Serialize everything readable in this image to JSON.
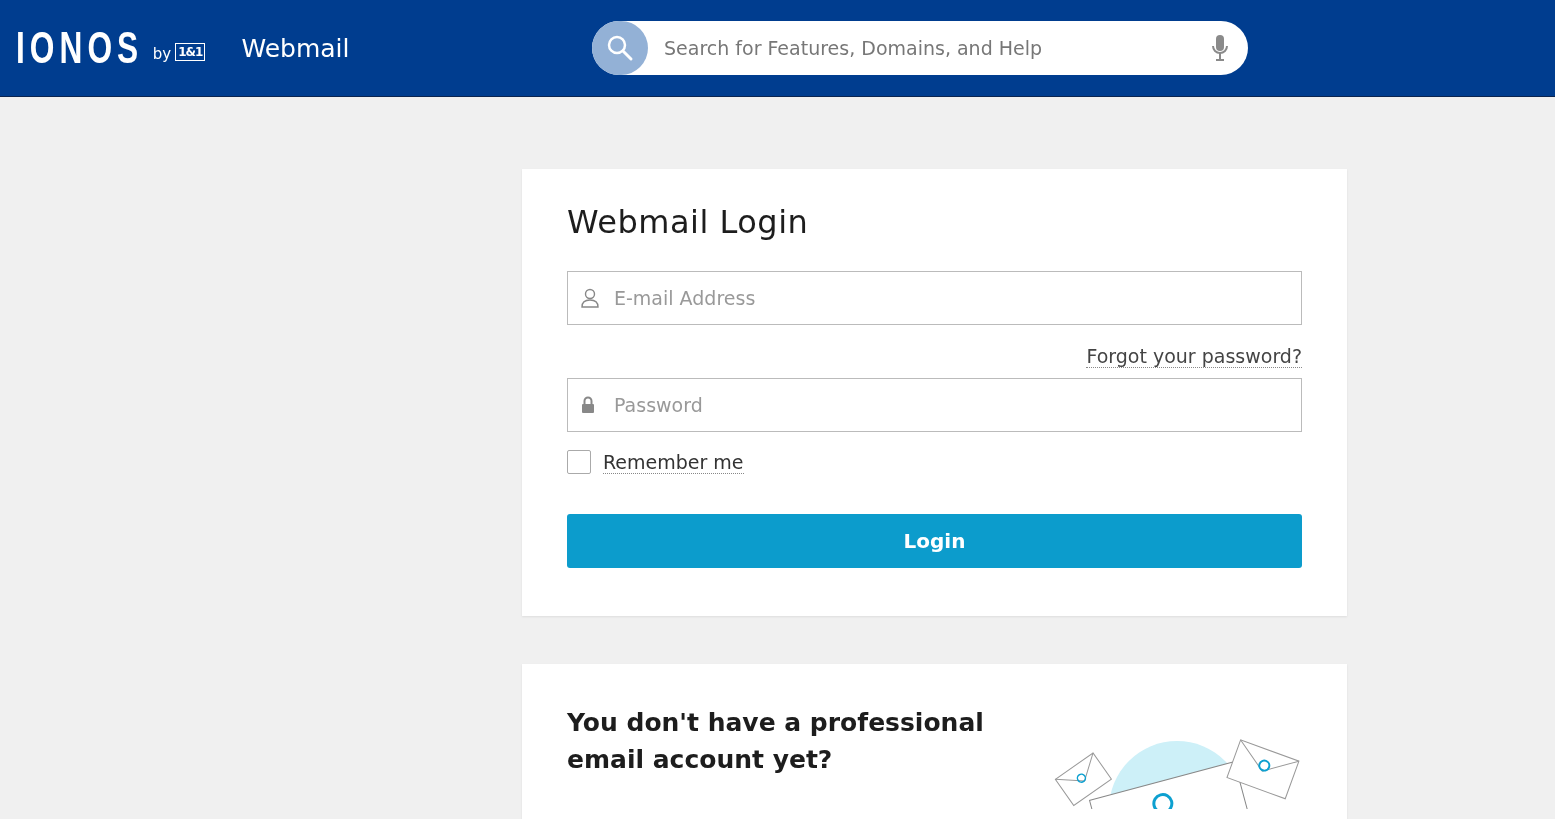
{
  "header": {
    "logo": "IONOS",
    "logo_by": "by",
    "logo_badge": "1&1",
    "product": "Webmail",
    "search": {
      "placeholder": "Search for Features, Domains, and Help"
    }
  },
  "login": {
    "title": "Webmail Login",
    "email": {
      "placeholder": "E-mail Address"
    },
    "forgot_link": "Forgot your password?",
    "password": {
      "placeholder": "Password"
    },
    "remember": {
      "label": "Remember me",
      "checked": false
    },
    "button": "Login"
  },
  "promo": {
    "title": "You don't have a professional email account yet?"
  }
}
